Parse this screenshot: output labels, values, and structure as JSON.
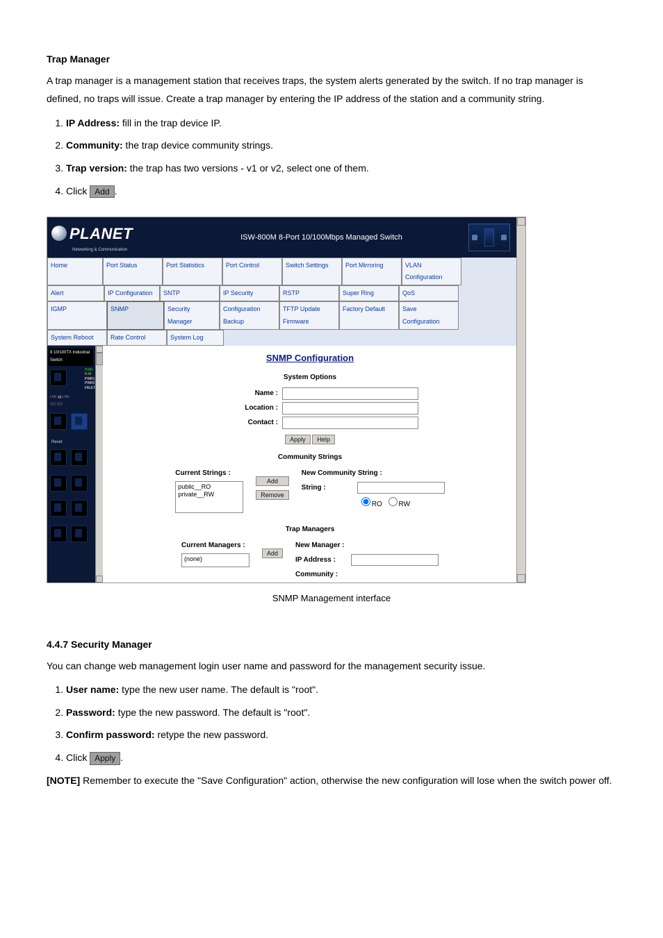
{
  "sections": {
    "trap_manager": {
      "title": "Trap Manager",
      "paragraph": "A trap manager is a management station that receives traps, the system alerts generated by the switch. If no trap manager is defined, no traps will issue. Create a trap manager by entering the IP address of the station and a community string.",
      "steps": [
        {
          "label": "IP Address:",
          "text": " fill in the trap device IP."
        },
        {
          "label": "Community:",
          "text": " the trap device community strings."
        },
        {
          "label": "Trap version:",
          "text": " the trap has two versions - v1 or v2, select one of them."
        }
      ],
      "click_prefix": "Click ",
      "click_button": "Add",
      "click_suffix": "."
    },
    "security_manager": {
      "title": "4.4.7 Security Manager",
      "paragraph": "You can change web management login user name and password for the management security issue.",
      "steps": [
        {
          "label": "User name:",
          "text": " type the new user name. The default is \"root\"."
        },
        {
          "label": "Password:",
          "text": " type the new password. The default is \"root\"."
        },
        {
          "label": "Confirm password:",
          "text": " retype the new password."
        }
      ],
      "click_prefix": "Click ",
      "click_button": "Apply",
      "click_suffix": ".",
      "note_label": "[NOTE]",
      "note_text": " Remember to execute the \"Save Configuration\" action, otherwise the new configuration will lose when the switch power off."
    }
  },
  "figure": {
    "caption": "SNMP Management interface",
    "header": {
      "brand": "PLANET",
      "brand_sub": "Networking & Communication",
      "title": "ISW-800M 8-Port 10/100Mbps Managed Switch"
    },
    "nav_rows": [
      [
        "Home",
        "Port Status",
        "Port Statistics",
        "Port Control",
        "Switch Settings",
        "Port Mirroring",
        "VLAN Configuration",
        "Alert"
      ],
      [
        "IP Configuration",
        "SNTP",
        "IP Security",
        "RSTP",
        "Super Ring",
        "QoS",
        "IGMP",
        "SNMP"
      ],
      [
        "Security Manager",
        "Configuration Backup",
        "TFTP Update Firmware",
        "Factory Default",
        "Save Configuration",
        "System Reboot",
        "Rate Control",
        "System Log"
      ]
    ],
    "nav_active": "SNMP",
    "sidebar": {
      "top_label": "8 10/100TX Industrial Switch",
      "leds": [
        "PWR",
        "R.M",
        "PWR1",
        "PWR2",
        "FAULT"
      ],
      "reset": "Reset"
    },
    "snmp": {
      "title": "SNMP Configuration",
      "system_options": {
        "title": "System Options",
        "name_label": "Name :",
        "location_label": "Location :",
        "contact_label": "Contact :",
        "apply": "Apply",
        "help": "Help"
      },
      "community": {
        "title": "Community Strings",
        "current_label": "Current Strings :",
        "current_items": [
          "public__RO",
          "private__RW"
        ],
        "new_label": "New Community String :",
        "string_label": "String :",
        "ro": "RO",
        "rw": "RW",
        "add": "Add",
        "remove": "Remove"
      },
      "trap": {
        "title": "Trap Managers",
        "current_label": "Current Managers :",
        "current_items": [
          "(none)"
        ],
        "new_label": "New Manager :",
        "ip_label": "IP Address :",
        "community_label": "Community :",
        "add": "Add"
      }
    }
  }
}
